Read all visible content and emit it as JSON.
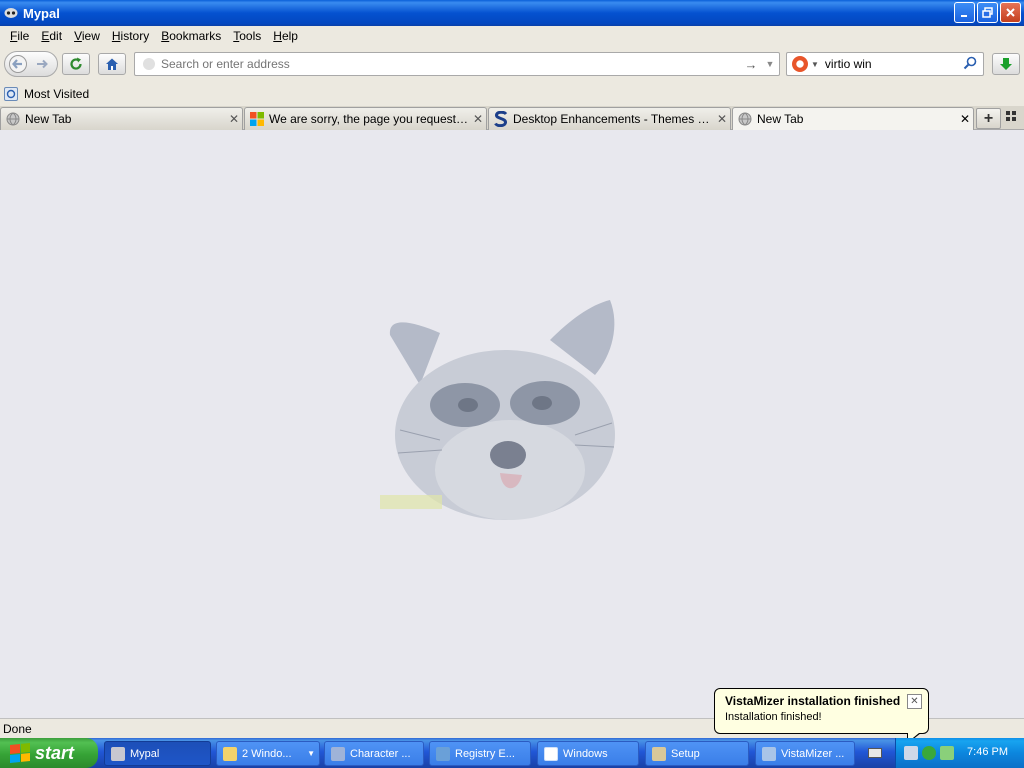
{
  "window": {
    "title": "Mypal"
  },
  "menu": [
    {
      "label": "File",
      "key": "F",
      "rest": "ile"
    },
    {
      "label": "Edit",
      "key": "E",
      "rest": "dit"
    },
    {
      "label": "View",
      "key": "V",
      "rest": "iew"
    },
    {
      "label": "History",
      "key": "H",
      "rest": "istory"
    },
    {
      "label": "Bookmarks",
      "key": "B",
      "rest": "ookmarks"
    },
    {
      "label": "Tools",
      "key": "T",
      "rest": "ools"
    },
    {
      "label": "Help",
      "key": "H",
      "rest": "elp"
    }
  ],
  "navbar": {
    "url_placeholder": "Search or enter address",
    "search_value": "virtio win"
  },
  "bookmarks": {
    "most_visited": "Most Visited"
  },
  "tabs": [
    {
      "title": "New Tab",
      "icon": "globe-icon"
    },
    {
      "title": "We are sorry, the page you requested ca...",
      "icon": "microsoft-logo-icon"
    },
    {
      "title": "Desktop Enhancements - Themes Down...",
      "icon": "s-logo-icon"
    },
    {
      "title": "New Tab",
      "icon": "globe-icon",
      "active": true
    }
  ],
  "status": {
    "text": "Done"
  },
  "balloon": {
    "title": "VistaMizer installation finished",
    "text": "Installation finished!"
  },
  "taskbar": {
    "start_label": "start",
    "tasks": [
      {
        "label": "Mypal",
        "active": true
      },
      {
        "label": "2 Windo..."
      },
      {
        "label": "Character ..."
      },
      {
        "label": "Registry E..."
      },
      {
        "label": "Windows"
      },
      {
        "label": "Setup"
      },
      {
        "label": "VistaMizer ..."
      }
    ],
    "clock": "7:46 PM"
  },
  "colors": {
    "titlebar": "#0552d0",
    "taskbar": "#2157d7",
    "start": "#36a336",
    "content_bg": "#e8e8ee",
    "balloon_bg": "#ffffe1"
  }
}
